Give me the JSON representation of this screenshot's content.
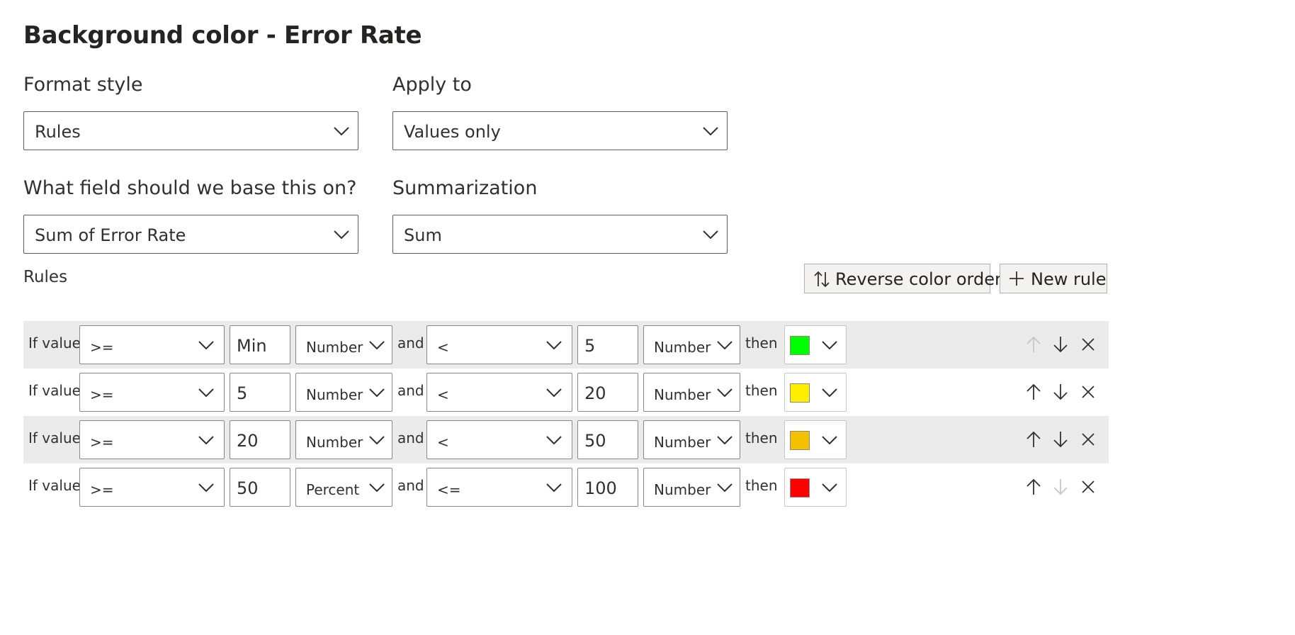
{
  "title": "Background color - Error Rate",
  "format_style": {
    "label": "Format style",
    "value": "Rules"
  },
  "apply_to": {
    "label": "Apply to",
    "value": "Values only"
  },
  "base_field": {
    "label": "What field should we base this on?",
    "value": "Sum of Error Rate"
  },
  "summarization": {
    "label": "Summarization",
    "value": "Sum"
  },
  "rules_label": "Rules",
  "buttons": {
    "reverse": "Reverse color order",
    "new_rule": "New rule"
  },
  "rules": [
    {
      "if_text": "If value",
      "op1": ">=",
      "val1": "Min",
      "type1": "Number",
      "and_text": "and",
      "op2": "<",
      "val2": "5",
      "type2": "Number",
      "then_text": "then",
      "color": "#00ff00",
      "up_enabled": false,
      "down_enabled": true
    },
    {
      "if_text": "If value",
      "op1": ">=",
      "val1": "5",
      "type1": "Number",
      "and_text": "and",
      "op2": "<",
      "val2": "20",
      "type2": "Number",
      "then_text": "then",
      "color": "#ffee00",
      "up_enabled": true,
      "down_enabled": true
    },
    {
      "if_text": "If value",
      "op1": ">=",
      "val1": "20",
      "type1": "Number",
      "and_text": "and",
      "op2": "<",
      "val2": "50",
      "type2": "Number",
      "then_text": "then",
      "color": "#f2c200",
      "up_enabled": true,
      "down_enabled": true
    },
    {
      "if_text": "If value",
      "op1": ">=",
      "val1": "50",
      "type1": "Percent",
      "and_text": "and",
      "op2": "<=",
      "val2": "100",
      "type2": "Number",
      "then_text": "then",
      "color": "#ff0000",
      "up_enabled": true,
      "down_enabled": false
    }
  ],
  "icons": {
    "dropdown": "chevron-down-icon",
    "reverse": "sort-arrows-icon",
    "add": "plus-icon",
    "up": "arrow-up-icon",
    "down": "arrow-down-icon",
    "delete": "close-icon"
  },
  "colors": {
    "border": "#605e5c",
    "row_shade": "#ebebeb",
    "disabled_icon": "#c8c6c4",
    "button_bg": "#f3f2f1"
  }
}
